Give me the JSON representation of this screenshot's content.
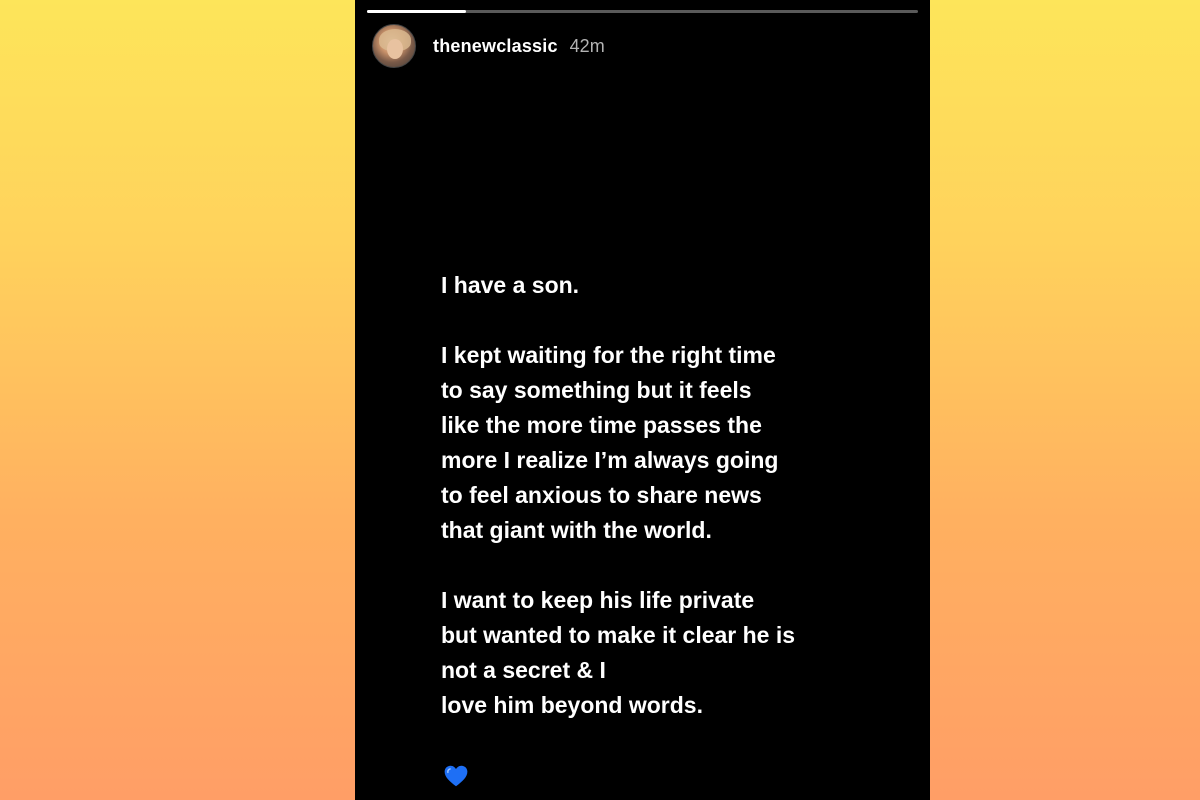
{
  "story": {
    "progress": 0.18,
    "username": "thenewclassic",
    "time_ago": "42m",
    "avatar": "profile-photo",
    "paragraphs": [
      [
        "I have a son."
      ],
      [
        "I kept waiting for the right time",
        "to say something but it feels",
        "like the more time passes the",
        "more I realize I’m always going",
        "to feel anxious to share news",
        "that giant with the world."
      ],
      [
        "I want to keep his life private",
        "but wanted to make it clear he is",
        "not a secret & I",
        "love him beyond words."
      ]
    ],
    "emoji": "blue-heart-icon",
    "heart_color": "#1e6ff5"
  }
}
